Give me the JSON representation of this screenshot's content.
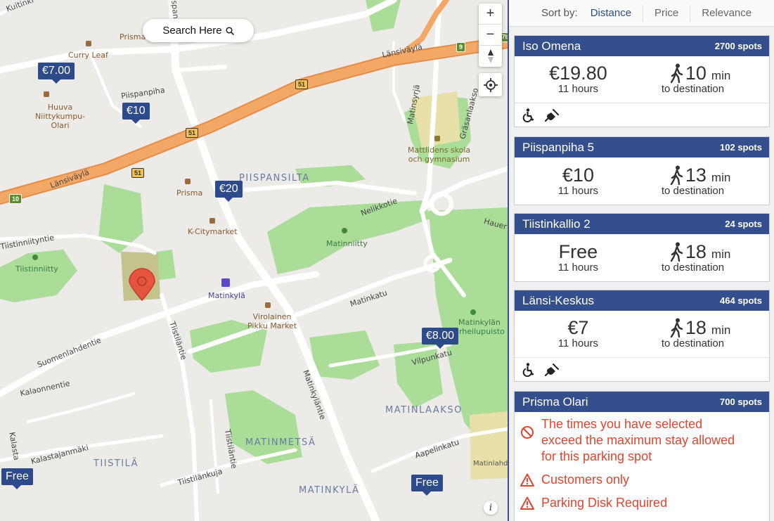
{
  "search_here": {
    "label": "Search Here"
  },
  "map": {
    "labels": {
      "curry_leaf": "Curry Leaf",
      "prisma_top": "Prisma",
      "piispanpiha": "Piispanpiha",
      "huuva": "Huuva\nNiittykumpu-\nOlari",
      "lansivayla_top": "Länsiväylä",
      "lansivayla_left": "Länsiväylä",
      "matinsyrja": "Matinsyrjä",
      "grasanlaakso": "Gräsanlaakso",
      "mattlidens": "Mattlidens skola\noch gymnasium",
      "piispansilta": "PIISPANSILTA",
      "prisma_mid": "Prisma",
      "k_citymarket": "K-Citymarket",
      "nelikkotie": "Nelikkotie",
      "hauer": "Hauer",
      "matinniitty": "Matinniitty",
      "tiistinniitty": "Tiistinniitty",
      "tiistinniityntie": "Tiistinniityntie",
      "matinkyla_station": "Matinkylä",
      "matinkatu": "Matinkatu",
      "virolainen": "Virolainen\nPikku Market",
      "tiistilantie": "Tiistiläntie",
      "suomenlahdentie": "Suomenlahdentie",
      "matinkylan_urheilupuisto": "Matinkylän\nurheilupuisto",
      "kalaonnentie": "Kalaonnentie",
      "vilpunkatu": "Vilpunkatu",
      "matinkylantie": "Matinkyläntie",
      "matinlaakso": "MATINLAAKSO",
      "matinmetsa": "MATINMETSÄ",
      "kalastajanmaki": "Kalastajanmäki",
      "tiistila": "TIISTILÄ",
      "tiistilankuja": "Tiistilänkuja",
      "aapelinkatu": "Aapelinkatu",
      "matinkyla_district": "MATINKYLÄ",
      "matinlahd": "Matinlahd",
      "kuitinki": "Kuitinki",
      "piispank": "Piispank",
      "price_kalasta": "Kalasta",
      "tiistilanti_small": "Tiistiläntie"
    },
    "shields": {
      "s51a": "51",
      "s51b": "51",
      "s51c": "51",
      "s9": "9",
      "s10": "10",
      "s7b": "7b"
    },
    "price_markers": [
      {
        "label": "€7.00"
      },
      {
        "label": "€10"
      },
      {
        "label": "€20"
      },
      {
        "label": "€8.00"
      },
      {
        "label": "Free"
      },
      {
        "label": "Free"
      }
    ],
    "controls": {
      "zoom_in": "+",
      "zoom_out": "−",
      "info": "i"
    }
  },
  "sort": {
    "label": "Sort by:",
    "options": [
      "Distance",
      "Price",
      "Relevance"
    ],
    "active": "Distance",
    "active_color": "#2d4a8a"
  },
  "cards": [
    {
      "name": "Iso Omena",
      "spots": "2700 spots",
      "price": "€19.80",
      "duration": "11 hours",
      "walk": "10",
      "walk_unit": "min",
      "walk_sub": "to destination",
      "amenities": [
        "wheelchair-icon",
        "ev-plug-icon"
      ]
    },
    {
      "name": "Piispanpiha 5",
      "spots": "102 spots",
      "price": "€10",
      "duration": "11 hours",
      "walk": "13",
      "walk_unit": "min",
      "walk_sub": "to destination",
      "amenities": []
    },
    {
      "name": "Tiistinkallio 2",
      "spots": "24 spots",
      "price": "Free",
      "duration": "11 hours",
      "walk": "18",
      "walk_unit": "min",
      "walk_sub": "to destination",
      "amenities": []
    },
    {
      "name": "Länsi-Keskus",
      "spots": "464 spots",
      "price": "€7",
      "duration": "11 hours",
      "walk": "18",
      "walk_unit": "min",
      "walk_sub": "to destination",
      "amenities": [
        "wheelchair-icon",
        "ev-plug-icon"
      ]
    },
    {
      "name": "Prisma Olari",
      "spots": "700 spots",
      "warnings": [
        {
          "icon": "no-entry-icon",
          "text": "The times you have selected exceed the maximum stay allowed for this parking spot"
        },
        {
          "icon": "warning-triangle-icon",
          "text": "Customers only"
        },
        {
          "icon": "warning-triangle-icon",
          "text": "Parking Disk Required"
        }
      ]
    }
  ],
  "colors": {
    "header": "#344f8e",
    "marker": "#2d4a8a",
    "warning": "#e0452e",
    "highway": "#f0a05a",
    "park": "#9fd98f"
  }
}
